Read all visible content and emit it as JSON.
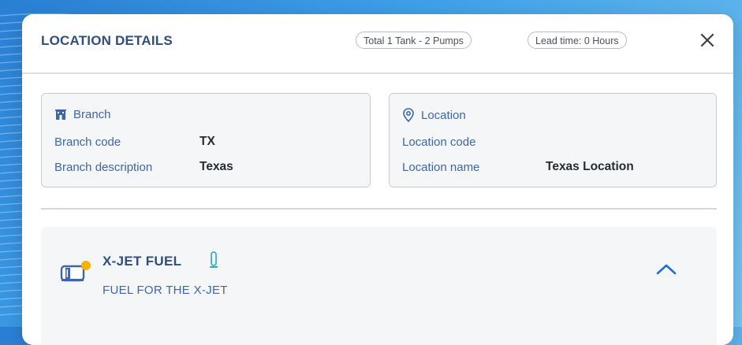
{
  "modal": {
    "title": "LOCATION DETAILS",
    "total_pill": "Total 1 Tank - 2 Pumps",
    "lead_pill": "Lead time: 0 Hours",
    "close_icon": "close-icon"
  },
  "branch": {
    "heading": "Branch",
    "icon": "building-icon",
    "code_label": "Branch code",
    "code_value": "TX",
    "description_label": "Branch description",
    "description_value": "Texas"
  },
  "location": {
    "heading": "Location",
    "icon": "location-pin-icon",
    "code_label": "Location code",
    "code_value": "",
    "name_label": "Location name",
    "name_value": "Texas Location"
  },
  "fuel": {
    "name": "X-JET FUEL",
    "description": "FUEL FOR THE X-JET",
    "tank_icon": "fuel-tank-icon",
    "gauge_icon": "tank-level-icon",
    "expand_icon": "chevron-up-icon",
    "status_color": "#f5b301"
  },
  "colors": {
    "accent": "#2f4e80",
    "link_blue": "#3e66a7",
    "chevron": "#1f6fd0"
  }
}
